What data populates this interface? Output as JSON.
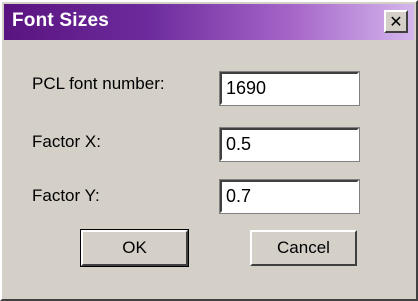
{
  "window": {
    "title": "Font Sizes",
    "close_glyph": "✕",
    "close_icon": "close-icon"
  },
  "fields": {
    "pcl_font_number": {
      "label": "PCL font number:",
      "value": "1690"
    },
    "factor_x": {
      "label": "Factor X:",
      "value": "0.5"
    },
    "factor_y": {
      "label": "Factor Y:",
      "value": "0.7"
    }
  },
  "buttons": {
    "ok": "OK",
    "cancel": "Cancel"
  },
  "colors": {
    "title_gradient_start": "#5a1480",
    "title_gradient_end": "#d4b6ec",
    "face": "#d4d0c8"
  }
}
